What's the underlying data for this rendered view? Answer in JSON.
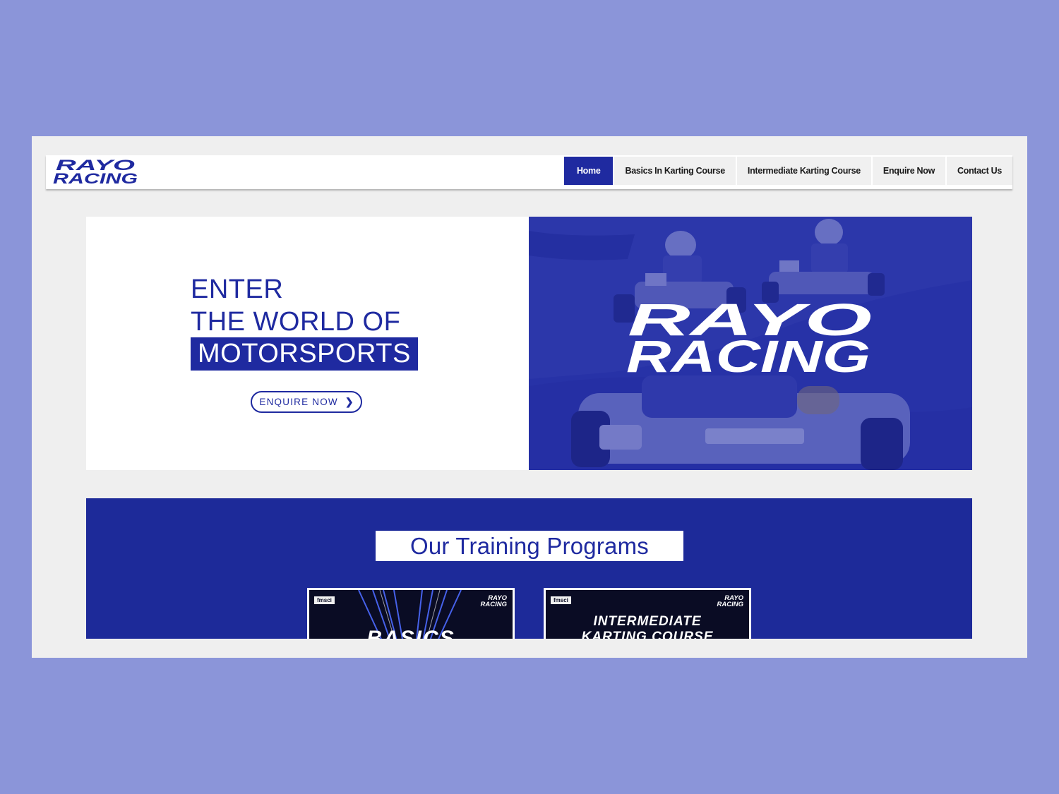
{
  "brand": {
    "logo_line1": "RAYO",
    "logo_line2": "RACING"
  },
  "nav": {
    "items": [
      {
        "label": "Home",
        "active": true
      },
      {
        "label": "Basics In Karting Course",
        "active": false
      },
      {
        "label": "Intermediate Karting Course",
        "active": false
      },
      {
        "label": "Enquire Now",
        "active": false
      },
      {
        "label": "Contact Us",
        "active": false
      }
    ]
  },
  "hero": {
    "line1": "ENTER",
    "line2": "THE WORLD OF",
    "highlight": "MOTORSPORTS",
    "cta_label": "ENQUIRE NOW",
    "cta_icon": "chevron-right-icon",
    "image_logo_line1": "RAYO",
    "image_logo_line2": "RACING"
  },
  "programs": {
    "title": "Our Training Programs",
    "cards": [
      {
        "badge": "fmsci",
        "logo_line1": "RAYO",
        "logo_line2": "RACING",
        "text": "BASICS"
      },
      {
        "badge": "fmsci",
        "logo_line1": "RAYO",
        "logo_line2": "RACING",
        "text_line1": "INTERMEDIATE",
        "text_line2": "KARTING COURSE"
      }
    ]
  },
  "colors": {
    "page_bg": "#8b95d9",
    "brand_blue": "#1f2aa0",
    "section_blue": "#1d2a99",
    "browser_bg": "#efefef"
  }
}
